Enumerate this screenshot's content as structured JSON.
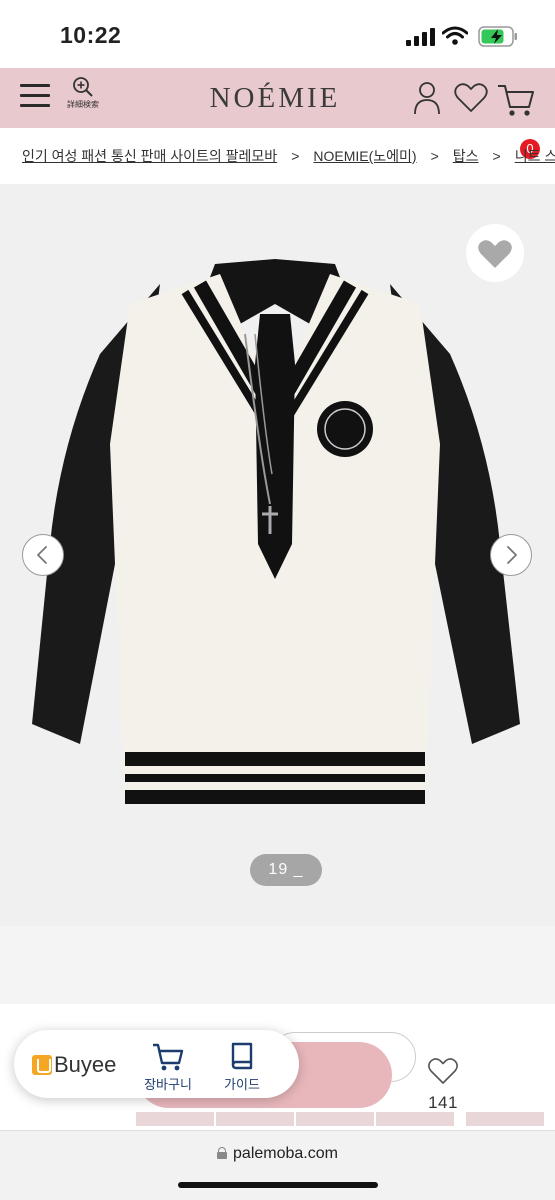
{
  "status_bar": {
    "time": "10:22"
  },
  "header": {
    "logo": "NOÉMIE",
    "search_label": "詳細検索",
    "cart_count": "0",
    "colors": {
      "background": "#e8c9cd",
      "badge": "#e31c23"
    }
  },
  "breadcrumb": {
    "items": [
      "인기 여성 패션 통신 판매 사이트의 팔레모바",
      "NOEMIE(노에미)",
      "탑스",
      "니트 스웨"
    ],
    "separator": ">"
  },
  "gallery": {
    "counter": "19 _",
    "prev_icon": "chevron-left-icon",
    "next_icon": "chevron-right-icon",
    "favorite_icon": "heart-icon"
  },
  "purchase": {
    "like_count": "141",
    "like_icon": "heart-outline-icon",
    "buy_button_color": "#e8b7bc"
  },
  "buyee": {
    "logo_text": "Buyee",
    "cart_label": "장바구니",
    "guide_label": "가이드",
    "accent": "#1d3c6e"
  },
  "browser": {
    "url": "palemoba.com"
  }
}
